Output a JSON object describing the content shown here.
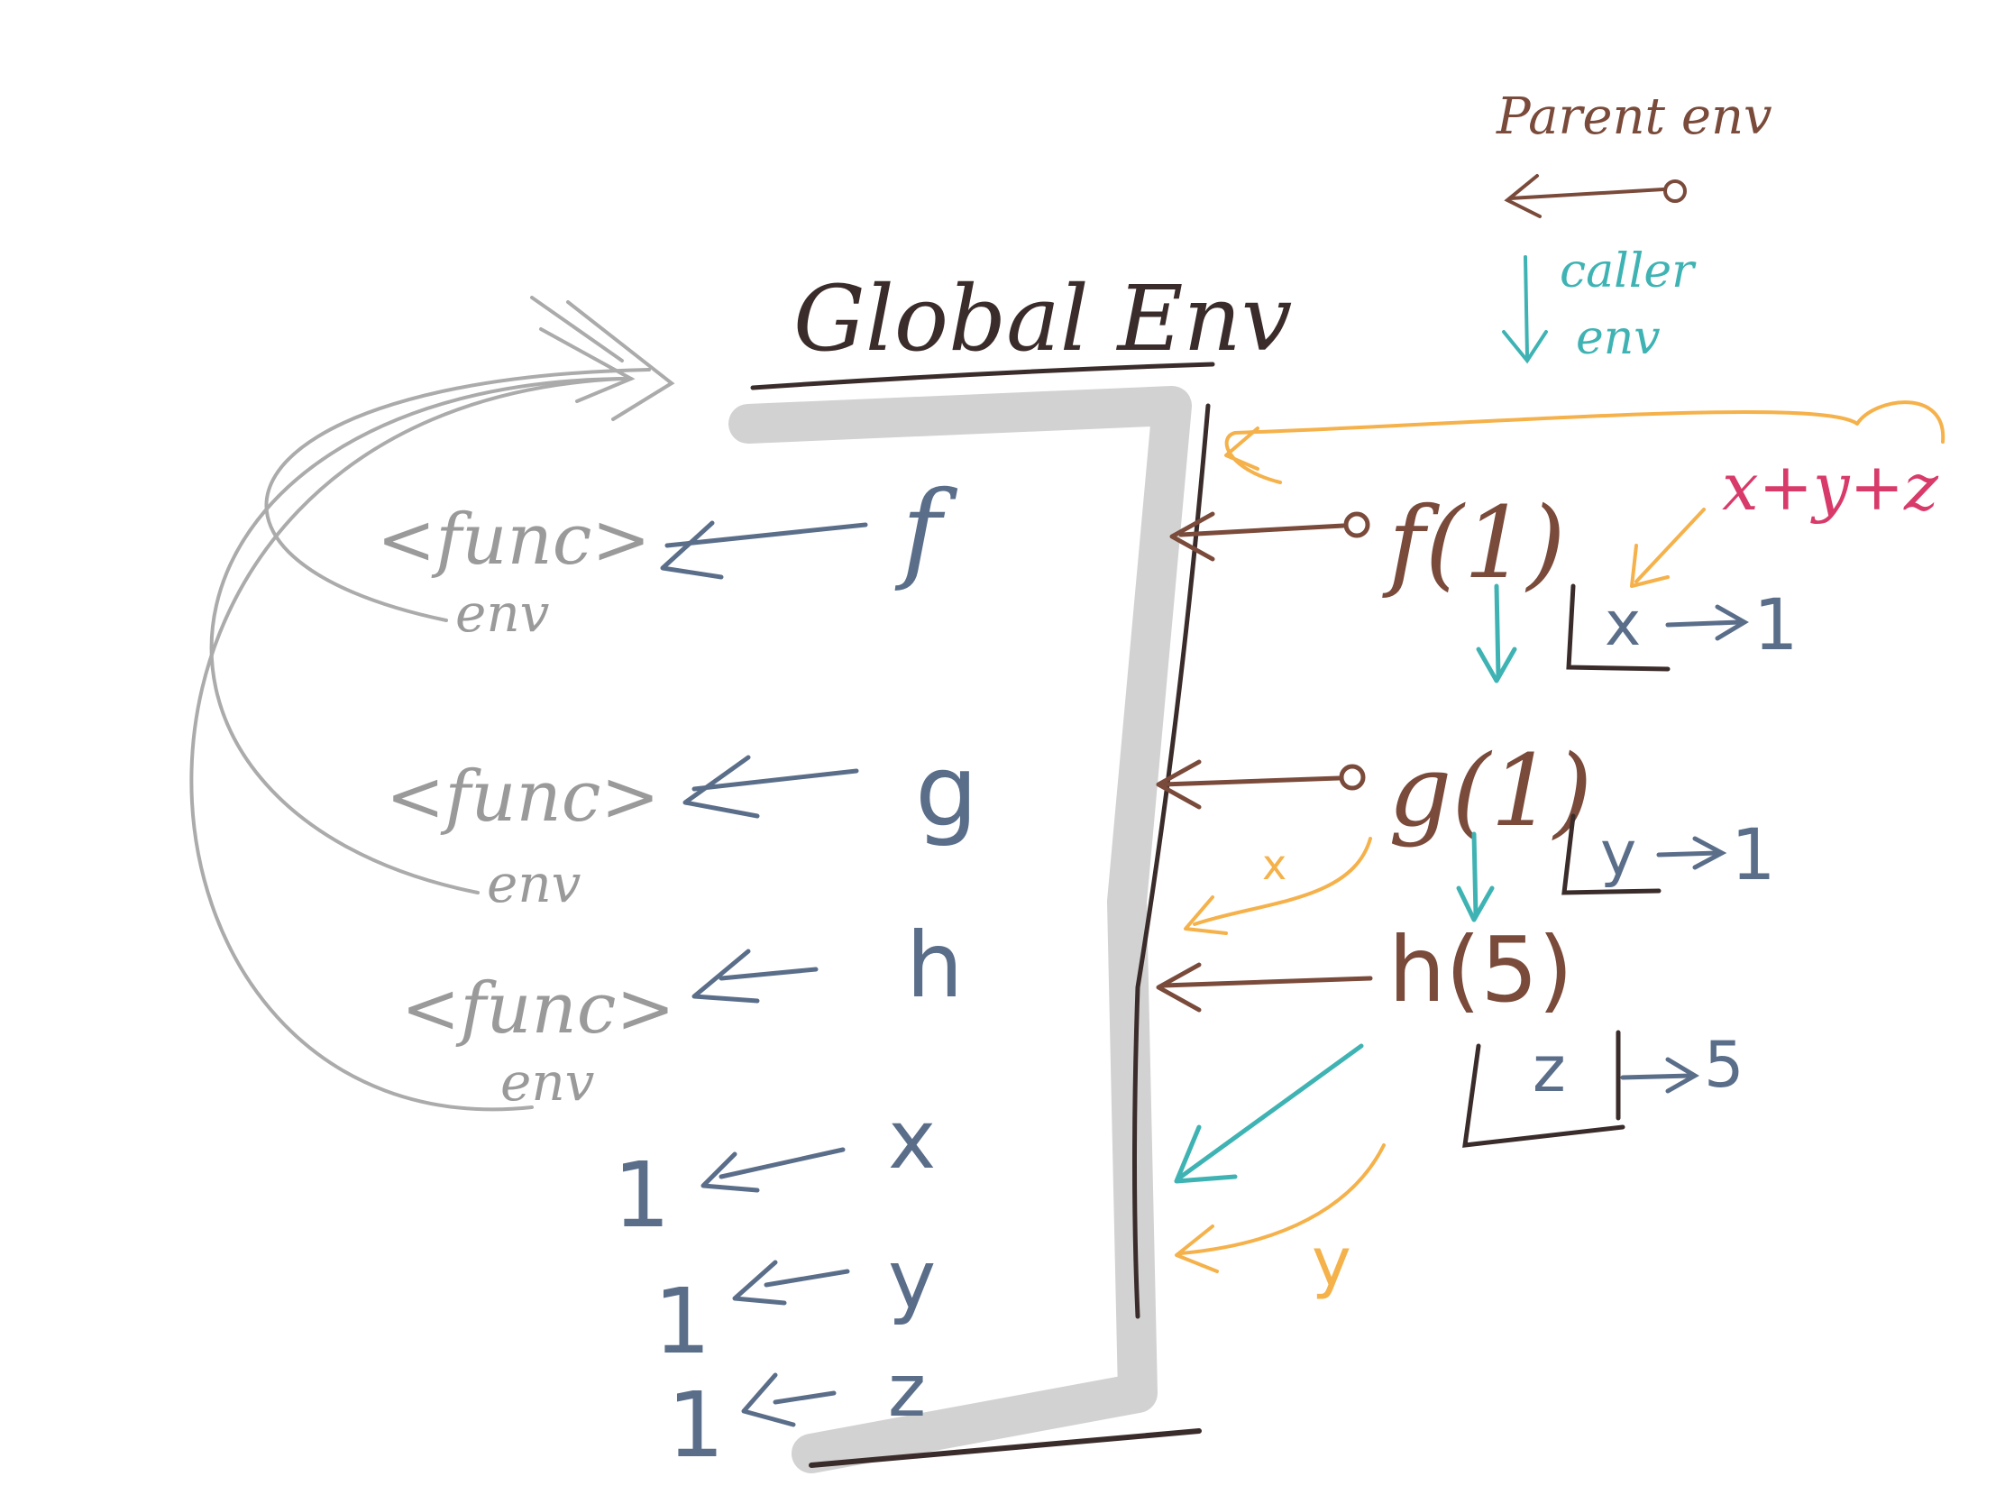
{
  "title": "Global Env",
  "legend": {
    "parent": "Parent env",
    "caller_line1": "caller",
    "caller_line2": "env"
  },
  "colors": {
    "ink": "#3a2c2a",
    "parent": "#7a4a3a",
    "caller": "#3fb3b3",
    "value": "#5a6e8a",
    "func": "#9a9a9a",
    "orange": "#f5b14a",
    "pink": "#d83a6a",
    "bracket_shadow": "#d2d2d2"
  },
  "bindings": [
    {
      "name": "f",
      "value": "<func>",
      "env": "env"
    },
    {
      "name": "g",
      "value": "<func>",
      "env": "env"
    },
    {
      "name": "h",
      "value": "<func>",
      "env": "env"
    },
    {
      "name": "x",
      "value": "1"
    },
    {
      "name": "y",
      "value": "1"
    },
    {
      "name": "z",
      "value": "1"
    }
  ],
  "calls": [
    {
      "label": "f(1)",
      "param": "x",
      "arg": "1"
    },
    {
      "label": "g(1)",
      "param": "y",
      "arg": "1"
    },
    {
      "label": "h(5)",
      "param": "z",
      "arg": "5"
    }
  ],
  "annotations": {
    "sum": "x+y+z",
    "x_mark": "x",
    "y_mark": "y"
  }
}
